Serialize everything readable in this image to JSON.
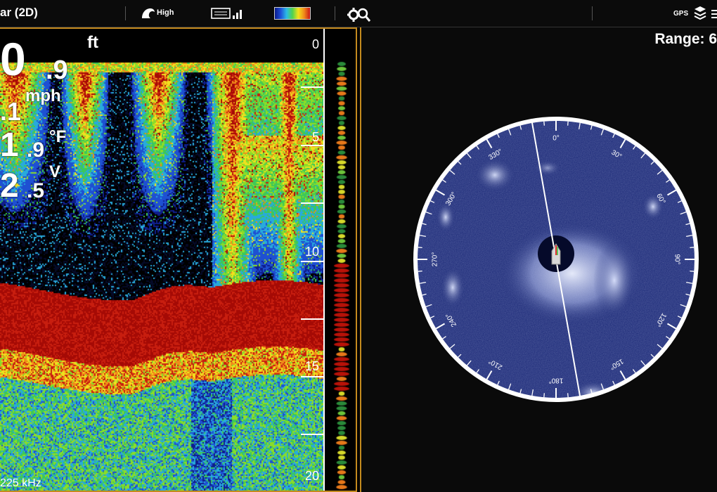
{
  "topbar": {
    "title": "ar (2D)",
    "sensitivity": "High",
    "gps": "GPS"
  },
  "sonar": {
    "depth_int": "0",
    "depth_dec": ".9",
    "depth_unit": "ft",
    "speed_int": ".1",
    "speed_unit": "mph",
    "temp_int": "1",
    "temp_dec": ".9",
    "temp_unit": "°F",
    "volt_int": "2",
    "volt_dec": ".5",
    "volt_unit": "V",
    "frequency": "225 kHz",
    "depth_labels": [
      "0",
      "5",
      "10",
      "15",
      "20"
    ]
  },
  "imaging": {
    "range": "Range: 6",
    "bearing_labels": [
      "0°",
      "30°",
      "60°",
      "90°",
      "120°",
      "150°",
      "180°",
      "210°",
      "240°",
      "270°",
      "300°",
      "330°"
    ]
  },
  "colors": {
    "frame": "#c48a1e",
    "scan_background": "#1c2a78",
    "return_red": "#b81208"
  }
}
